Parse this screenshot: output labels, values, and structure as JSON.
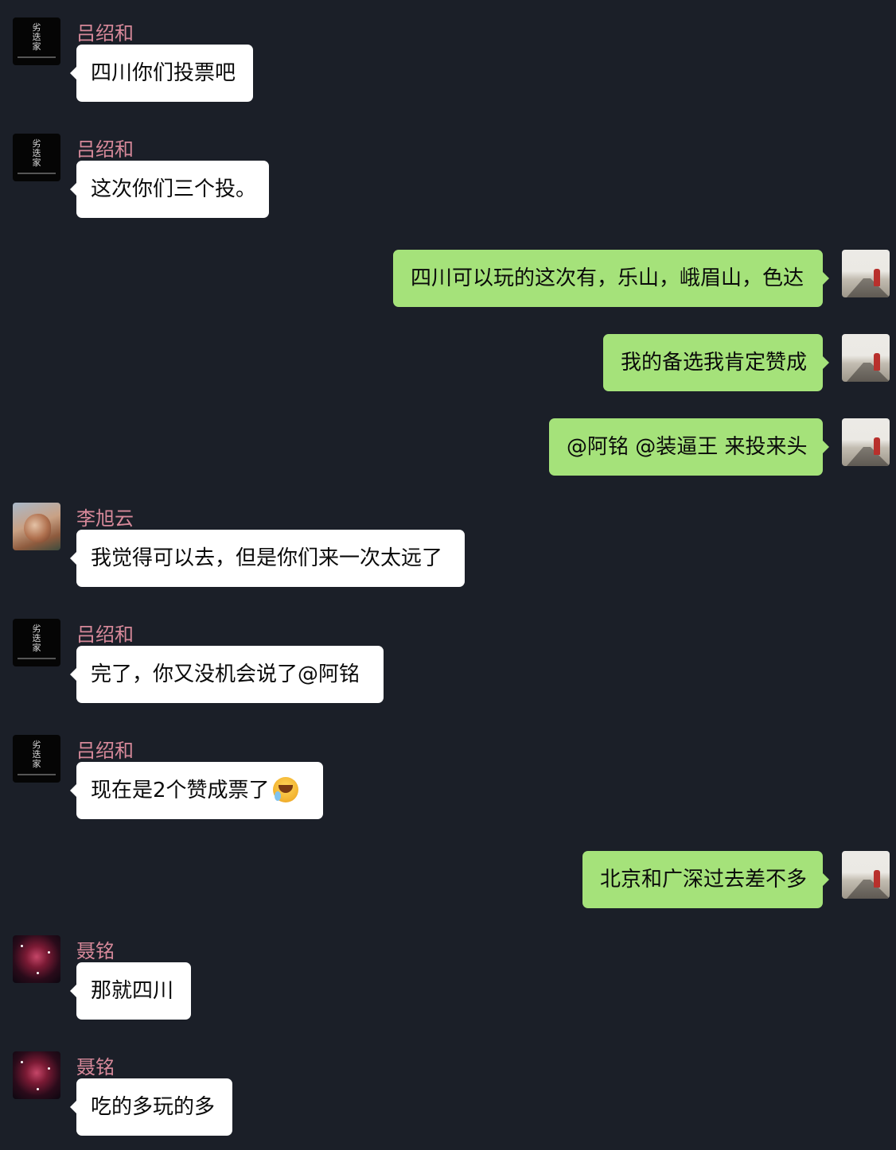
{
  "chat": {
    "messages": [
      {
        "direction": "in",
        "sender": "吕绍和",
        "avatar": "black-text-avatar",
        "text": "四川你们投票吧"
      },
      {
        "direction": "in",
        "sender": "吕绍和",
        "avatar": "black-text-avatar",
        "text": "这次你们三个投。"
      },
      {
        "direction": "out",
        "sender": "",
        "avatar": "road-avatar",
        "text": "四川可以玩的这次有，乐山，峨眉山，色达"
      },
      {
        "direction": "out",
        "sender": "",
        "avatar": "road-avatar",
        "text": "我的备选我肯定赞成"
      },
      {
        "direction": "out",
        "sender": "",
        "avatar": "road-avatar",
        "text": "@阿铭 @装逼王 来投来头"
      },
      {
        "direction": "in",
        "sender": "李旭云",
        "avatar": "person-photo-avatar",
        "text": "我觉得可以去，但是你们来一次太远了"
      },
      {
        "direction": "in",
        "sender": "吕绍和",
        "avatar": "black-text-avatar",
        "text": "完了，你又没机会说了@阿铭"
      },
      {
        "direction": "in",
        "sender": "吕绍和",
        "avatar": "black-text-avatar",
        "text": "现在是2个赞成票了",
        "emoji": "laughing-crying-emoji"
      },
      {
        "direction": "out",
        "sender": "",
        "avatar": "road-avatar",
        "text": "北京和广深过去差不多"
      },
      {
        "direction": "in",
        "sender": "聂铭",
        "avatar": "galaxy-avatar",
        "text": "那就四川"
      },
      {
        "direction": "in",
        "sender": "聂铭",
        "avatar": "galaxy-avatar",
        "text": "吃的多玩的多"
      }
    ]
  },
  "avatar_labels": {
    "black_avatar_text": "劣\n迭\n家"
  },
  "colors": {
    "background": "#1b1f28",
    "sender_name": "#d7899a",
    "incoming_bubble": "#ffffff",
    "outgoing_bubble": "#a5e27a"
  }
}
